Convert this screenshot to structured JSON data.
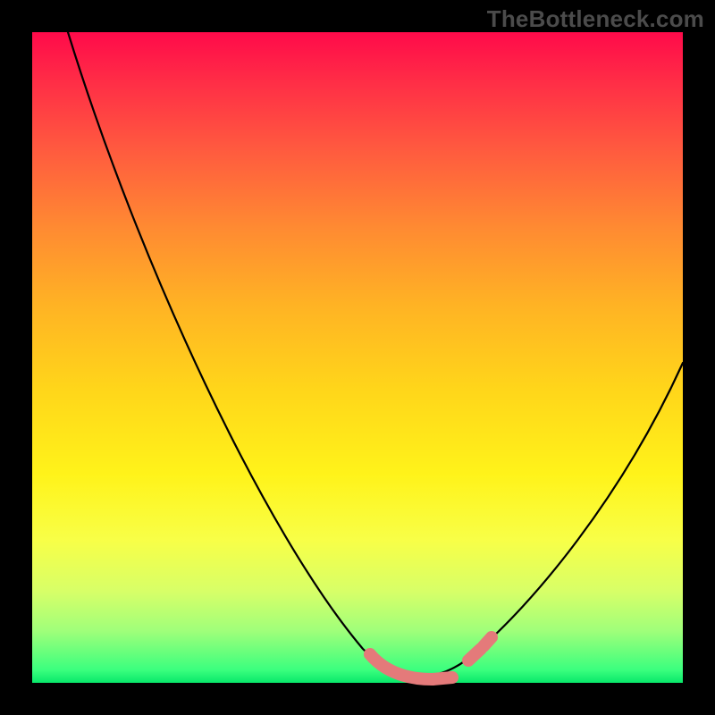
{
  "watermark": "TheBottleneck.com",
  "chart_data": {
    "type": "line",
    "title": "",
    "xlabel": "",
    "ylabel": "",
    "x": [
      0.0,
      0.05,
      0.1,
      0.15,
      0.2,
      0.25,
      0.3,
      0.35,
      0.4,
      0.45,
      0.5,
      0.55,
      0.6,
      0.62,
      0.65,
      0.7,
      0.75,
      0.8,
      0.85,
      0.9,
      0.95,
      1.0
    ],
    "values": [
      1.0,
      0.89,
      0.79,
      0.69,
      0.59,
      0.5,
      0.41,
      0.32,
      0.23,
      0.14,
      0.07,
      0.02,
      0.0,
      0.0,
      0.01,
      0.04,
      0.09,
      0.16,
      0.24,
      0.32,
      0.41,
      0.5
    ],
    "xlim": [
      0,
      1
    ],
    "ylim": [
      0,
      1
    ],
    "annotations": {
      "optimum_band": {
        "x_start": 0.55,
        "x_end": 0.72,
        "y": 0.0
      }
    },
    "colors": {
      "curve": "#000000",
      "band_marker": "#e47a7a",
      "gradient_top": "#ff0a4a",
      "gradient_bottom": "#08e86a"
    }
  }
}
